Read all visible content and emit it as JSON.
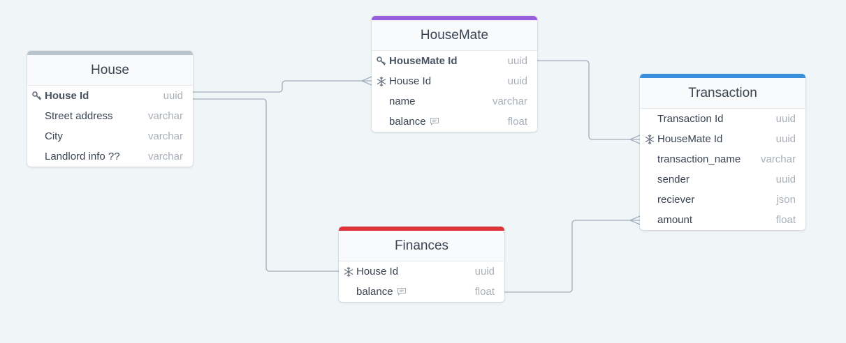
{
  "colors": {
    "background": "#f0f5f8",
    "house_accent": "#b9c3cb",
    "housemate_accent": "#9a5fdc",
    "transaction_accent": "#3a8fdc",
    "finances_accent": "#e03338",
    "connector": "#a3aebb"
  },
  "tables": {
    "house": {
      "title": "House",
      "fields": [
        {
          "name": "House Id",
          "type": "uuid",
          "icon": "key-icon"
        },
        {
          "name": "Street address",
          "type": "varchar"
        },
        {
          "name": "City",
          "type": "varchar"
        },
        {
          "name": "Landlord info ??",
          "type": "varchar"
        }
      ]
    },
    "housemate": {
      "title": "HouseMate",
      "fields": [
        {
          "name": "HouseMate Id",
          "type": "uuid",
          "icon": "key-icon"
        },
        {
          "name": "House Id",
          "type": "uuid",
          "icon": "snowflake-icon"
        },
        {
          "name": "name",
          "type": "varchar"
        },
        {
          "name": "balance",
          "type": "float",
          "note": "comment-icon"
        }
      ]
    },
    "transaction": {
      "title": "Transaction",
      "fields": [
        {
          "name": "Transaction Id",
          "type": "uuid"
        },
        {
          "name": "HouseMate Id",
          "type": "uuid",
          "icon": "snowflake-icon"
        },
        {
          "name": "transaction_name",
          "type": "varchar"
        },
        {
          "name": "sender",
          "type": "uuid"
        },
        {
          "name": "reciever",
          "type": "json"
        },
        {
          "name": "amount",
          "type": "float"
        }
      ]
    },
    "finances": {
      "title": "Finances",
      "fields": [
        {
          "name": "House Id",
          "type": "uuid",
          "icon": "snowflake-icon"
        },
        {
          "name": "balance",
          "type": "float",
          "note": "comment-icon"
        }
      ]
    }
  },
  "relations": [
    {
      "from": "House.House Id",
      "to": "HouseMate.House Id",
      "to_end": "crows-foot"
    },
    {
      "from": "House.House Id",
      "to": "Finances.House Id"
    },
    {
      "from": "HouseMate.HouseMate Id",
      "to": "Transaction.HouseMate Id",
      "to_end": "crows-foot"
    },
    {
      "from": "Finances.balance",
      "to": "Transaction.amount",
      "to_end": "crows-foot"
    }
  ]
}
